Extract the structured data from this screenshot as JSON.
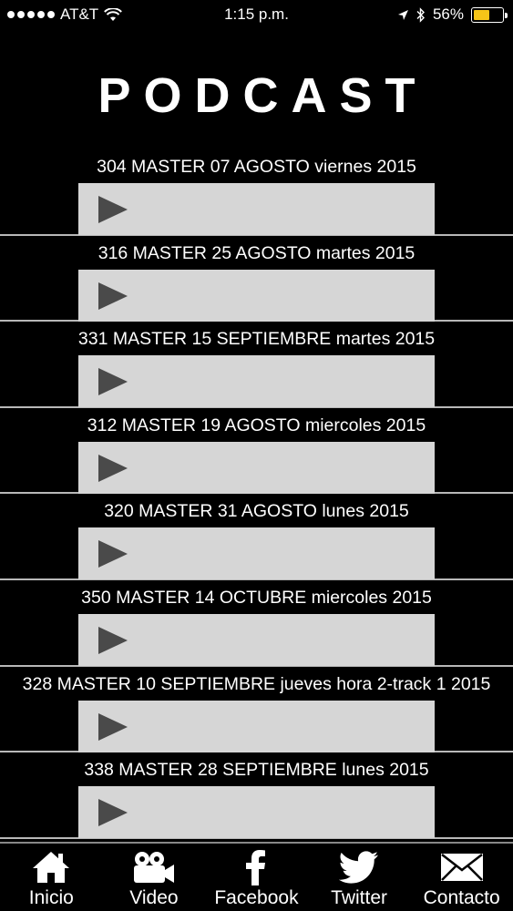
{
  "status_bar": {
    "carrier": "AT&T",
    "time": "1:15 p.m.",
    "battery_percent": "56%",
    "battery_level": 0.56,
    "battery_color": "#f5c518"
  },
  "header": {
    "title": "PODCAST"
  },
  "episodes": [
    {
      "title": "304 MASTER 07 AGOSTO viernes 2015"
    },
    {
      "title": "316 MASTER 25 AGOSTO martes 2015"
    },
    {
      "title": "331 MASTER 15 SEPTIEMBRE martes 2015"
    },
    {
      "title": "312 MASTER 19 AGOSTO miercoles 2015"
    },
    {
      "title": "320 MASTER 31 AGOSTO lunes 2015"
    },
    {
      "title": "350 MASTER 14 OCTUBRE miercoles 2015"
    },
    {
      "title": "328 MASTER 10 SEPTIEMBRE jueves hora 2-track 1 2015"
    },
    {
      "title": "338 MASTER 28 SEPTIEMBRE lunes 2015"
    }
  ],
  "tab_bar": {
    "tabs": [
      {
        "label": "Inicio",
        "icon": "home-icon"
      },
      {
        "label": "Video",
        "icon": "video-camera-icon"
      },
      {
        "label": "Facebook",
        "icon": "facebook-icon"
      },
      {
        "label": "Twitter",
        "icon": "twitter-bird-icon"
      },
      {
        "label": "Contacto",
        "icon": "envelope-icon"
      }
    ]
  }
}
